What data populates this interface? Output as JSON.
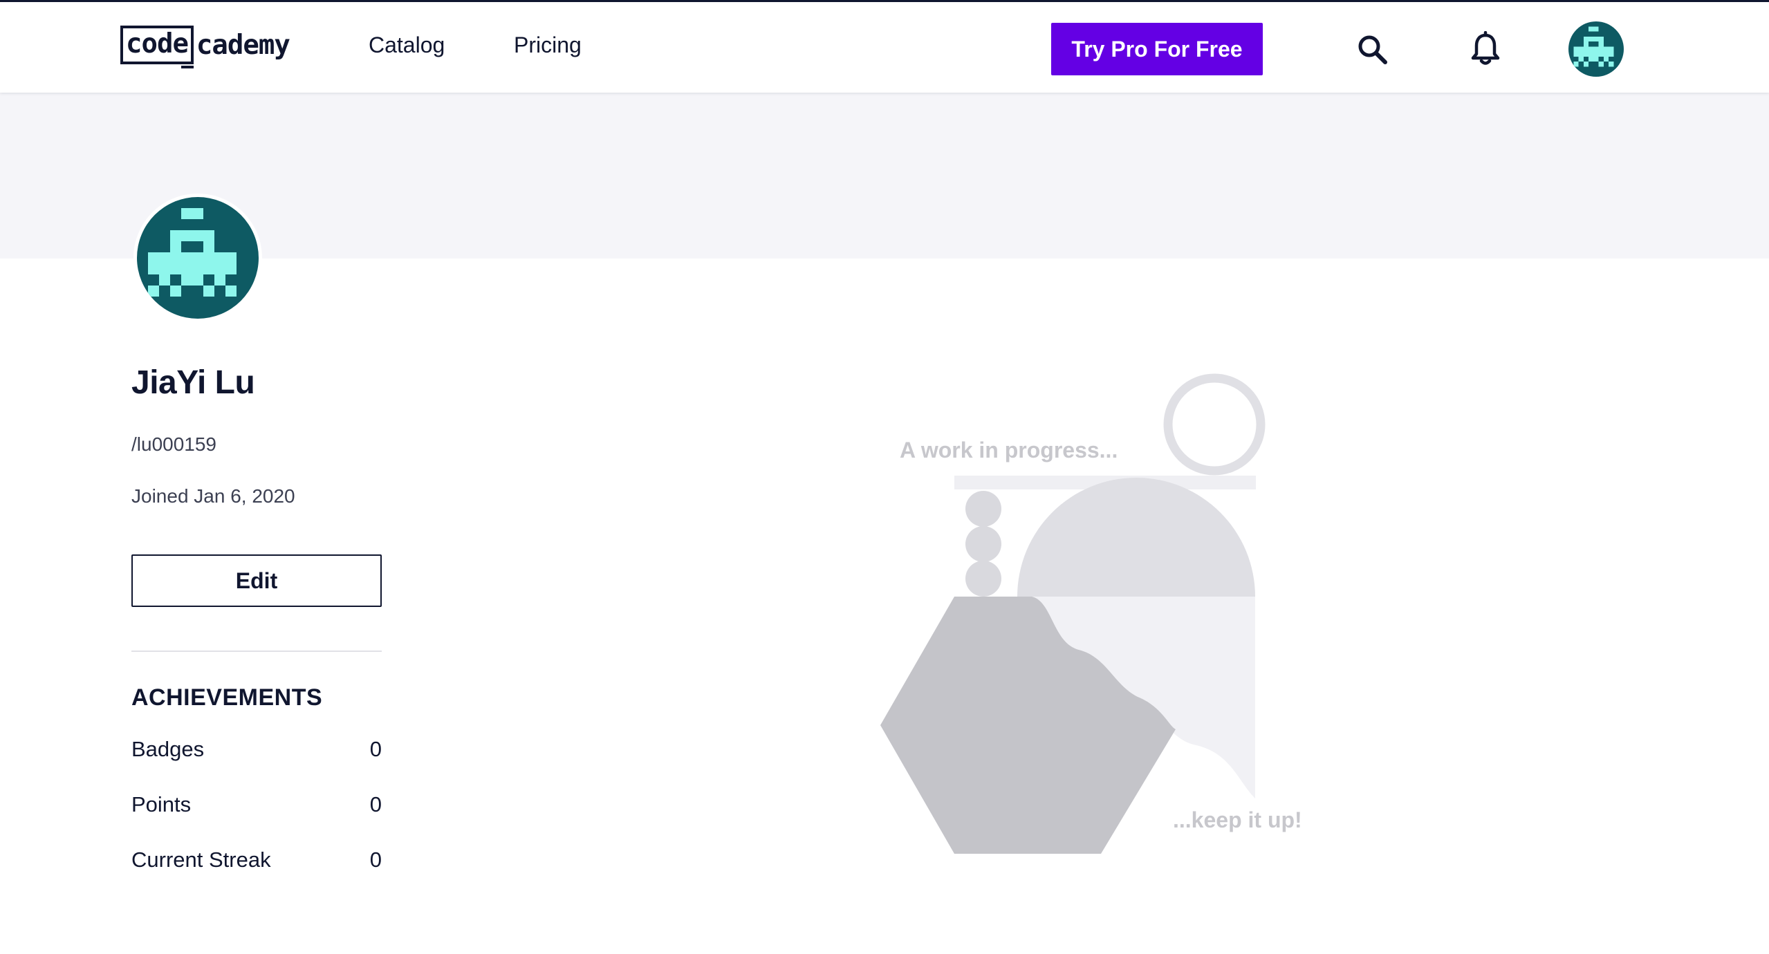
{
  "header": {
    "logo": {
      "code": "code",
      "rest": "cademy"
    },
    "nav": [
      {
        "label": "Catalog"
      },
      {
        "label": "Pricing"
      }
    ],
    "cta_label": "Try Pro For Free",
    "search_icon": "search-icon",
    "bell_icon": "bell-icon",
    "avatar_icon": "pixel-alien-avatar"
  },
  "profile": {
    "name": "JiaYi Lu",
    "handle": "/lu000159",
    "joined": "Joined Jan 6, 2020",
    "edit_label": "Edit"
  },
  "achievements": {
    "title": "ACHIEVEMENTS",
    "rows": [
      {
        "label": "Badges",
        "value": "0"
      },
      {
        "label": "Points",
        "value": "0"
      },
      {
        "label": "Current Streak",
        "value": "0"
      }
    ]
  },
  "empty_state": {
    "top_text": "A work in progress...",
    "bottom_text": "...keep it up!"
  },
  "colors": {
    "brand_navy": "#10162f",
    "cta_purple": "#6400e4",
    "banner_bg": "#f5f5f9",
    "avatar_teal": "#0e5a63",
    "avatar_mint": "#8ef6ec"
  }
}
